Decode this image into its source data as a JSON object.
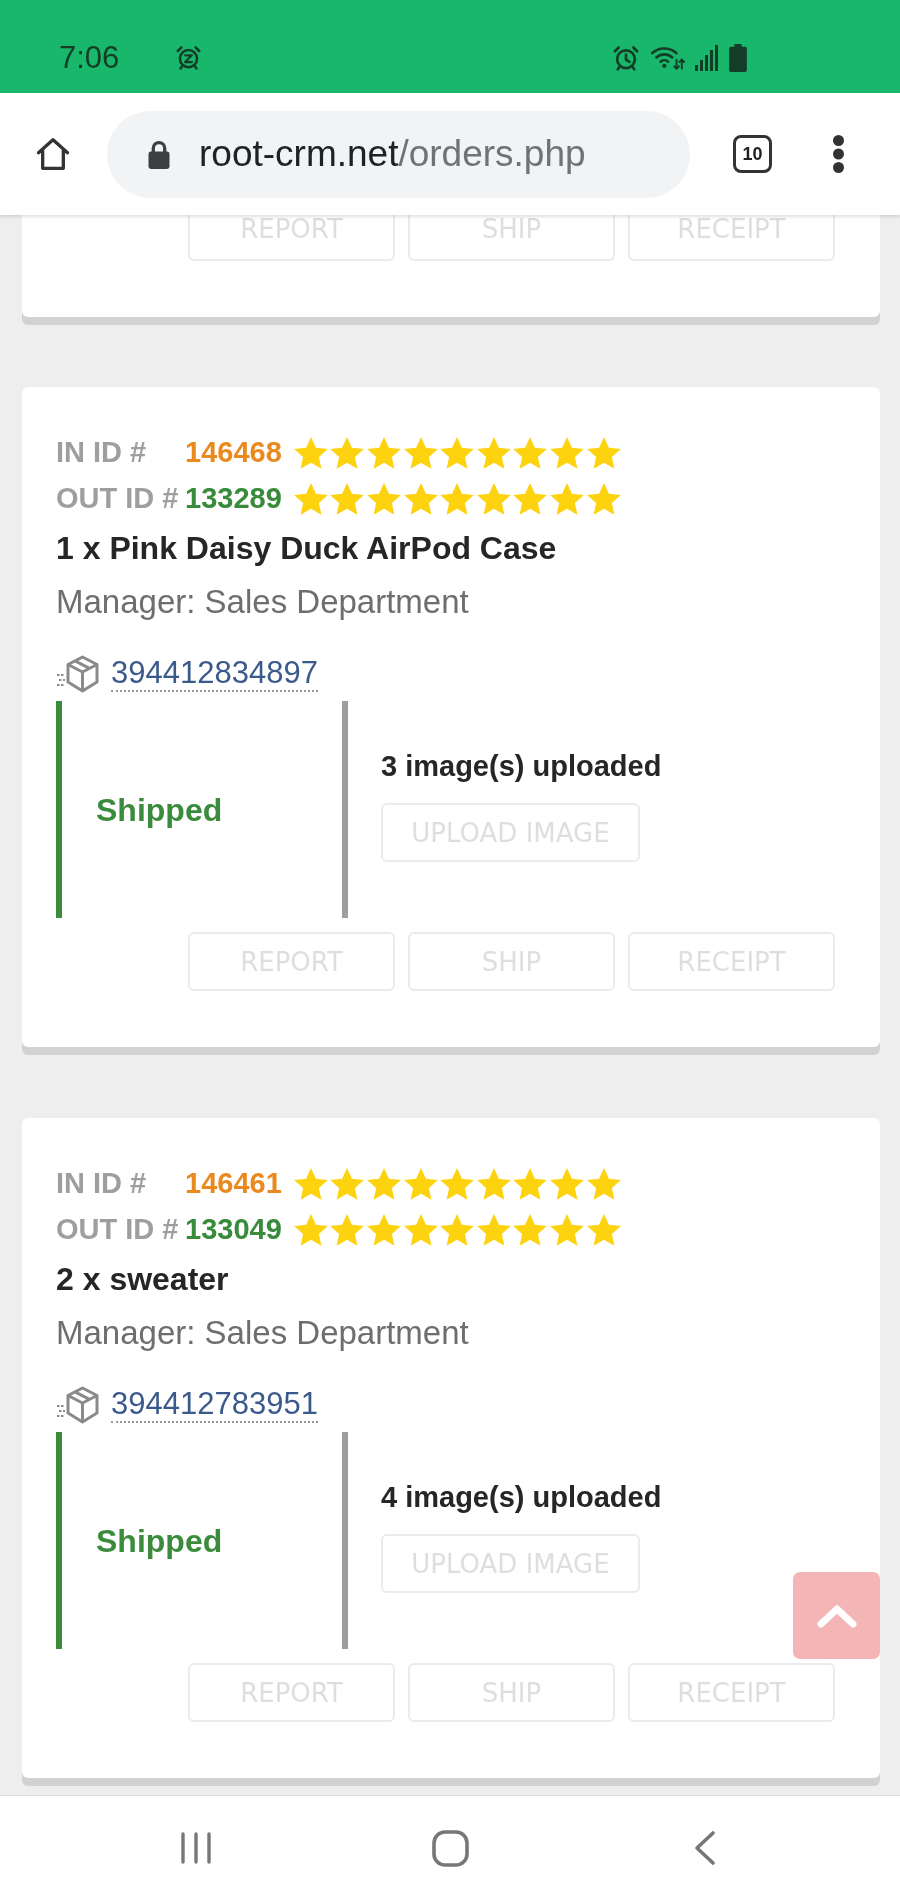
{
  "status_bar": {
    "time": "7:06"
  },
  "browser": {
    "url_host": "root-crm.net",
    "url_path": "/orders.php",
    "tab_count": "10"
  },
  "previous_order": {
    "actions": [
      {
        "label": "REPORT",
        "disabled": true
      },
      {
        "label": "SHIP",
        "disabled": true
      },
      {
        "label": "RECEIPT",
        "disabled": true
      }
    ]
  },
  "orders": [
    {
      "in": {
        "label": "IN ID #",
        "id": "146468",
        "stars": 9
      },
      "out": {
        "label": "OUT ID #",
        "id": "133289",
        "stars": 9
      },
      "item": "1 x Pink Daisy Duck AirPod Case",
      "manager": "Manager: Sales Department",
      "tracking": "394412834897",
      "status": "Shipped",
      "images": "3 image(s) uploaded",
      "upload": {
        "label": "UPLOAD IMAGE",
        "disabled": true
      },
      "actions": [
        {
          "label": "REPORT",
          "disabled": true
        },
        {
          "label": "SHIP",
          "disabled": true
        },
        {
          "label": "RECEIPT",
          "disabled": true
        }
      ]
    },
    {
      "in": {
        "label": "IN ID #",
        "id": "146461",
        "stars": 9
      },
      "out": {
        "label": "OUT ID #",
        "id": "133049",
        "stars": 9
      },
      "item": "2 x sweater",
      "manager": "Manager: Sales Department",
      "tracking": "394412783951",
      "status": "Shipped",
      "images": "4 image(s) uploaded",
      "upload": {
        "label": "UPLOAD IMAGE",
        "disabled": true
      },
      "actions": [
        {
          "label": "REPORT",
          "disabled": true
        },
        {
          "label": "SHIP",
          "disabled": true
        },
        {
          "label": "RECEIPT",
          "disabled": true
        }
      ]
    }
  ]
}
